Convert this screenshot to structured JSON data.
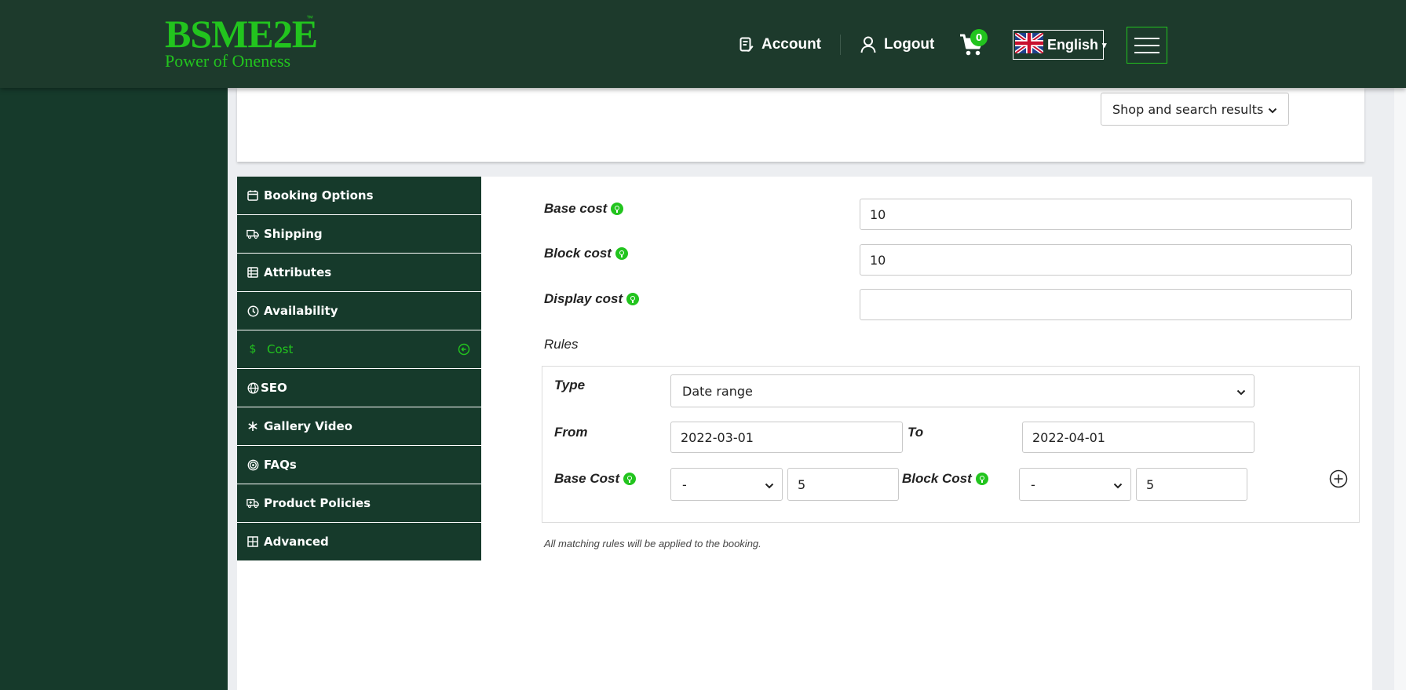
{
  "header": {
    "logo_main": "BSME2E",
    "logo_tm": "™",
    "logo_tagline": "Power of Oneness",
    "account_label": "Account",
    "logout_label": "Logout",
    "cart_count": "0",
    "language_label": "English",
    "language_caret": "▾"
  },
  "top_filter": {
    "selected": "Shop and search results"
  },
  "sidebar": {
    "tabs": [
      {
        "label": "Booking Options",
        "icon": "calendar-icon"
      },
      {
        "label": "Shipping",
        "icon": "truck-icon"
      },
      {
        "label": "Attributes",
        "icon": "list-icon"
      },
      {
        "label": "Availability",
        "icon": "clock-icon"
      },
      {
        "label": "Cost",
        "icon": "dollar-icon",
        "active": true
      },
      {
        "label": "SEO",
        "icon": "globe-icon"
      },
      {
        "label": "Gallery Video",
        "icon": "snowflake-icon"
      },
      {
        "label": "FAQs",
        "icon": "target-icon"
      },
      {
        "label": "Product Policies",
        "icon": "ambulance-icon"
      },
      {
        "label": "Advanced",
        "icon": "grid-icon"
      }
    ],
    "cost_symbol": "$"
  },
  "cost": {
    "base_cost_label": "Base cost",
    "base_cost_value": "10",
    "block_cost_label": "Block cost",
    "block_cost_value": "10",
    "display_cost_label": "Display cost",
    "display_cost_value": "",
    "rules_label": "Rules",
    "rule": {
      "type_label": "Type",
      "type_value": "Date range",
      "from_label": "From",
      "from_value": "2022-03-01",
      "to_label": "To",
      "to_value": "2022-04-01",
      "base_cost_label": "Base Cost",
      "base_cost_operator": "-",
      "base_cost_value": "5",
      "block_cost_label": "Block Cost",
      "block_cost_operator": "-",
      "block_cost_value": "5"
    },
    "note": "All matching rules will be applied to the booking."
  },
  "colors": {
    "brand_green": "#22c41e",
    "dark_green": "#163a2b",
    "header_green": "#1d3a2c"
  }
}
